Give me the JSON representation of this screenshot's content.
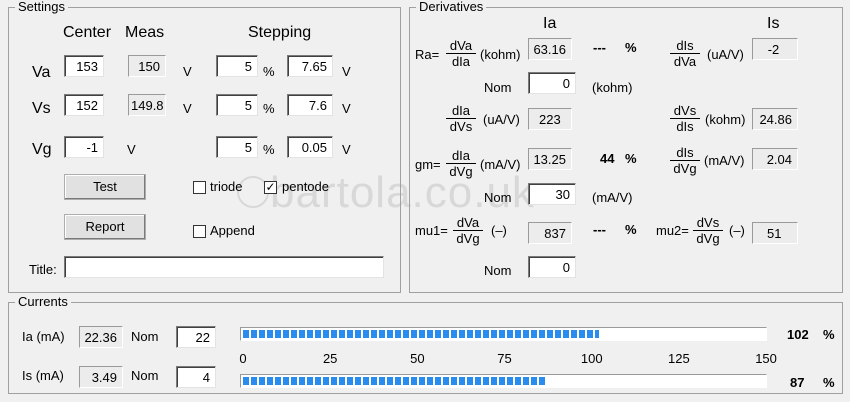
{
  "settings": {
    "title": "Settings",
    "col_center": "Center",
    "col_meas": "Meas",
    "col_stepping": "Stepping",
    "rows": [
      {
        "label": "Va",
        "center": "153",
        "meas": "150",
        "unit": "V",
        "step_pct": "5",
        "pct": "%",
        "step_val": "7.65",
        "step_unit": "V"
      },
      {
        "label": "Vs",
        "center": "152",
        "meas": "149.8",
        "unit": "V",
        "step_pct": "5",
        "pct": "%",
        "step_val": "7.6",
        "step_unit": "V"
      },
      {
        "label": "Vg",
        "center": "-1",
        "unit": "V",
        "step_pct": "5",
        "pct": "%",
        "step_val": "0.05",
        "step_unit": "V"
      }
    ],
    "test_button": "Test",
    "report_button": "Report",
    "triode_label": "triode",
    "pentode_label": "pentode",
    "append_label": "Append",
    "triode_checked": false,
    "pentode_checked": true,
    "append_checked": false,
    "title_label": "Title:",
    "title_value": "",
    "check_mark": "✓"
  },
  "derivatives": {
    "title": "Derivatives",
    "ia_header": "Ia",
    "is_header": "Is",
    "ra_label": "Ra=",
    "ra_num": "dVa",
    "ra_den": "dIa",
    "ra_unit": "(kohm)",
    "ra_value": "63.16",
    "ra_dev": "---",
    "ra_pct": "%",
    "ra_nom_label": "Nom",
    "ra_nom": "0",
    "ra_nom_unit": "(kohm)",
    "dis_dva_num": "dIs",
    "dis_dva_den": "dVa",
    "dis_dva_unit": "(uA/V)",
    "dis_dva_value": "-2",
    "dia_dvs_num": "dIa",
    "dia_dvs_den": "dVs",
    "dia_dvs_unit": "(uA/V)",
    "dia_dvs_value": "223",
    "dvs_dis_num": "dVs",
    "dvs_dis_den": "dIs",
    "dvs_dis_unit": "(kohm)",
    "dvs_dis_value": "24.86",
    "gm_label": "gm=",
    "gm_num": "dIa",
    "gm_den": "dVg",
    "gm_unit": "(mA/V)",
    "gm_value": "13.25",
    "gm_dev": "44",
    "gm_pct": "%",
    "gm_nom_label": "Nom",
    "gm_nom": "30",
    "gm_nom_unit": "(mA/V)",
    "dis_dvg_num": "dIs",
    "dis_dvg_den": "dVg",
    "dis_dvg_unit": "(mA/V)",
    "dis_dvg_value": "2.04",
    "mu1_label": "mu1=",
    "mu1_num": "dVa",
    "mu1_den": "dVg",
    "mu1_unit": "(–)",
    "mu1_value": "837",
    "mu1_dev": "---",
    "mu1_pct": "%",
    "mu1_nom_label": "Nom",
    "mu1_nom": "0",
    "mu2_label": "mu2=",
    "mu2_num": "dVs",
    "mu2_den": "dVg",
    "mu2_unit": "(–)",
    "mu2_value": "51"
  },
  "currents": {
    "title": "Currents",
    "ia_label": "Ia (mA)",
    "ia_value": "22.36",
    "ia_nom_label": "Nom",
    "ia_nom": "22",
    "ia_pct": "102",
    "ia_pct_sign": "%",
    "is_label": "Is (mA)",
    "is_value": "3.49",
    "is_nom_label": "Nom",
    "is_nom": "4",
    "is_pct": "87",
    "is_pct_sign": "%",
    "scale_ticks": [
      "0",
      "25",
      "50",
      "75",
      "100",
      "125",
      "150"
    ],
    "scale_max": 150,
    "ia_bar_percent": 102,
    "is_bar_percent": 87
  },
  "watermark": "bartola.co.uk",
  "colors": {
    "bar_fill": "#2b8cf0",
    "background": "#f0f0f0"
  }
}
